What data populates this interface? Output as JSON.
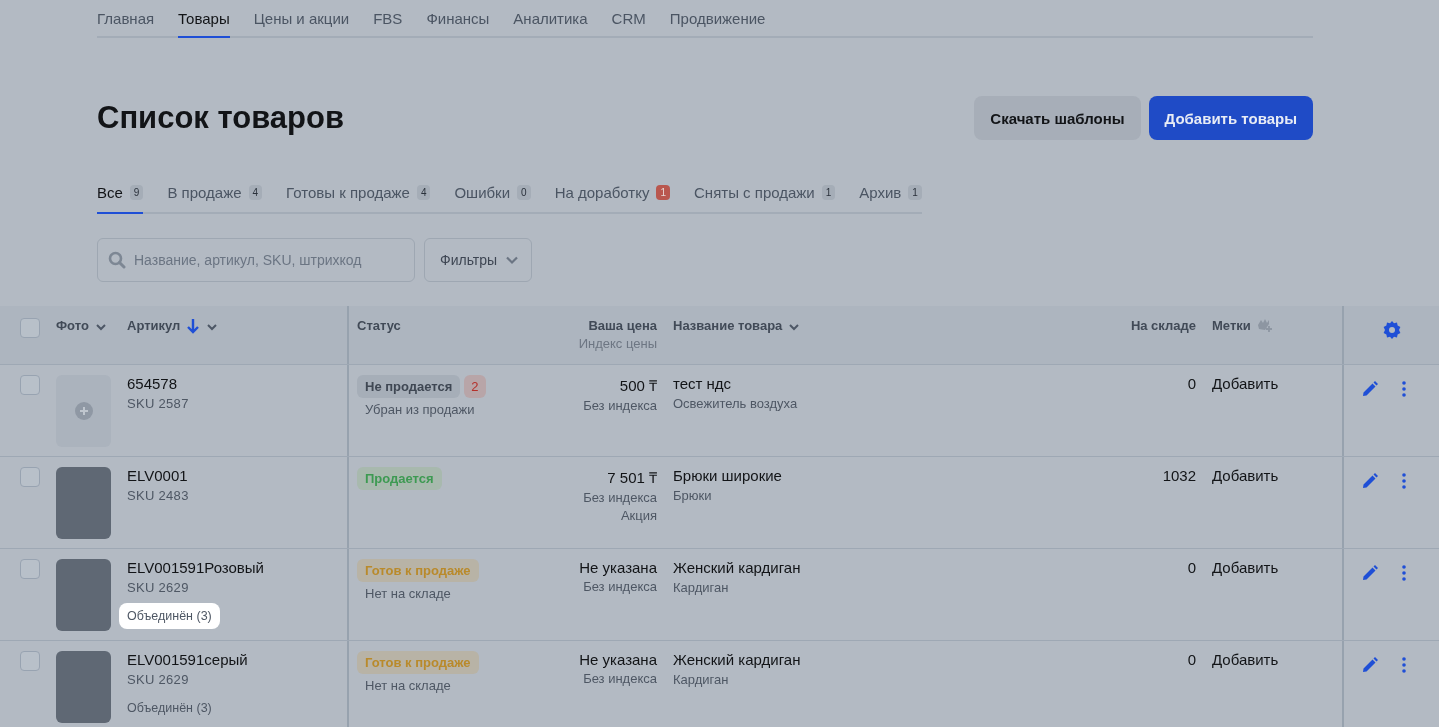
{
  "nav": [
    {
      "label": "Главная",
      "selected": false
    },
    {
      "label": "Товары",
      "selected": true
    },
    {
      "label": "Цены и акции",
      "selected": false
    },
    {
      "label": "FBS",
      "selected": false
    },
    {
      "label": "Финансы",
      "selected": false
    },
    {
      "label": "Аналитика",
      "selected": false
    },
    {
      "label": "CRM",
      "selected": false
    },
    {
      "label": "Продвижение",
      "selected": false
    }
  ],
  "page_title": "Список товаров",
  "buttons": [
    {
      "label": "Скачать шаблоны",
      "kind": "secondary"
    },
    {
      "label": "Добавить товары",
      "kind": "primary"
    }
  ],
  "tabs": [
    {
      "label": "Все",
      "count": "9",
      "selected": true,
      "alert": false
    },
    {
      "label": "В продаже",
      "count": "4",
      "selected": false,
      "alert": false
    },
    {
      "label": "Готовы к продаже",
      "count": "4",
      "selected": false,
      "alert": false
    },
    {
      "label": "Ошибки",
      "count": "0",
      "selected": false,
      "alert": false
    },
    {
      "label": "На доработку",
      "count": "1",
      "selected": false,
      "alert": true
    },
    {
      "label": "Сняты с продажи",
      "count": "1",
      "selected": false,
      "alert": false
    },
    {
      "label": "Архив",
      "count": "1",
      "selected": false,
      "alert": false
    }
  ],
  "search": {
    "placeholder": "Название, артикул, SKU, штрихкод"
  },
  "filters_button": "Фильтры",
  "table": {
    "columns": {
      "photo": "Фото",
      "article": "Артикул",
      "status": "Статус",
      "price": "Ваша цена",
      "price_index": "Индекс цены",
      "name": "Название товара",
      "stock": "На складе",
      "tags": "Метки"
    },
    "select_all_checked": false,
    "rows": [
      {
        "checked": false,
        "has_photo": false,
        "article": "654578",
        "sku": "SKU 2587",
        "status": {
          "label": "Не продается",
          "kind": "inactive"
        },
        "status_count": "2",
        "status_note": "Убран из продажи",
        "price": "500 ₸",
        "price_index": "Без индекса",
        "name": "тест ндс",
        "category": "Освежитель воздуха",
        "stock": "0",
        "tags": "Добавить"
      },
      {
        "checked": false,
        "has_photo": true,
        "article": "ELV0001",
        "sku": "SKU 2483",
        "status": {
          "label": "Продается",
          "kind": "selling"
        },
        "price": "7 501 ₸",
        "price_index": "Без индекса",
        "price_extra": "Акция",
        "name": "Брюки широкие",
        "category": "Брюки",
        "stock": "1032",
        "tags": "Добавить"
      },
      {
        "checked": false,
        "has_photo": true,
        "article": "ELV001591Розовый",
        "sku": "SKU 2629",
        "merged": {
          "label": "Объединён (3)",
          "highlighted": true
        },
        "status": {
          "label": "Готов к продаже",
          "kind": "ready"
        },
        "status_note": "Нет на складе",
        "price": "Не указана",
        "price_index": "Без индекса",
        "name": "Женский кардиган",
        "category": "Кардиган",
        "stock": "0",
        "tags": "Добавить"
      },
      {
        "checked": false,
        "has_photo": true,
        "article": "ELV001591серый",
        "sku": "SKU 2629",
        "merged": {
          "label": "Объединён (3)",
          "highlighted": false
        },
        "status": {
          "label": "Готов к продаже",
          "kind": "ready"
        },
        "status_note": "Нет на складе",
        "price": "Не указана",
        "price_index": "Без индекса",
        "name": "Женский кардиган",
        "category": "Кардиган",
        "stock": "0",
        "tags": "Добавить"
      }
    ]
  }
}
